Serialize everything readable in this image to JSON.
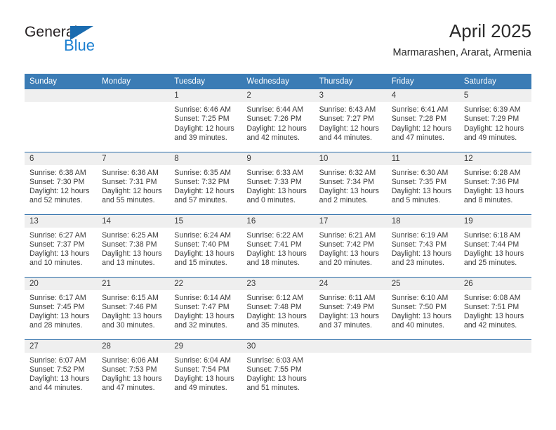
{
  "brand": {
    "name_part1": "General",
    "name_part2": "Blue",
    "logo_icon": "triangle-flag-icon",
    "accent_color": "#1b7fd0",
    "header_color": "#3b7cb5"
  },
  "header": {
    "title": "April 2025",
    "subtitle": "Marmarashen, Ararat, Armenia"
  },
  "weekday_headers": [
    "Sunday",
    "Monday",
    "Tuesday",
    "Wednesday",
    "Thursday",
    "Friday",
    "Saturday"
  ],
  "weeks": [
    [
      {
        "day": "",
        "sunrise": "",
        "sunset": "",
        "daylight_line1": "",
        "daylight_line2": ""
      },
      {
        "day": "",
        "sunrise": "",
        "sunset": "",
        "daylight_line1": "",
        "daylight_line2": ""
      },
      {
        "day": "1",
        "sunrise": "Sunrise: 6:46 AM",
        "sunset": "Sunset: 7:25 PM",
        "daylight_line1": "Daylight: 12 hours",
        "daylight_line2": "and 39 minutes."
      },
      {
        "day": "2",
        "sunrise": "Sunrise: 6:44 AM",
        "sunset": "Sunset: 7:26 PM",
        "daylight_line1": "Daylight: 12 hours",
        "daylight_line2": "and 42 minutes."
      },
      {
        "day": "3",
        "sunrise": "Sunrise: 6:43 AM",
        "sunset": "Sunset: 7:27 PM",
        "daylight_line1": "Daylight: 12 hours",
        "daylight_line2": "and 44 minutes."
      },
      {
        "day": "4",
        "sunrise": "Sunrise: 6:41 AM",
        "sunset": "Sunset: 7:28 PM",
        "daylight_line1": "Daylight: 12 hours",
        "daylight_line2": "and 47 minutes."
      },
      {
        "day": "5",
        "sunrise": "Sunrise: 6:39 AM",
        "sunset": "Sunset: 7:29 PM",
        "daylight_line1": "Daylight: 12 hours",
        "daylight_line2": "and 49 minutes."
      }
    ],
    [
      {
        "day": "6",
        "sunrise": "Sunrise: 6:38 AM",
        "sunset": "Sunset: 7:30 PM",
        "daylight_line1": "Daylight: 12 hours",
        "daylight_line2": "and 52 minutes."
      },
      {
        "day": "7",
        "sunrise": "Sunrise: 6:36 AM",
        "sunset": "Sunset: 7:31 PM",
        "daylight_line1": "Daylight: 12 hours",
        "daylight_line2": "and 55 minutes."
      },
      {
        "day": "8",
        "sunrise": "Sunrise: 6:35 AM",
        "sunset": "Sunset: 7:32 PM",
        "daylight_line1": "Daylight: 12 hours",
        "daylight_line2": "and 57 minutes."
      },
      {
        "day": "9",
        "sunrise": "Sunrise: 6:33 AM",
        "sunset": "Sunset: 7:33 PM",
        "daylight_line1": "Daylight: 13 hours",
        "daylight_line2": "and 0 minutes."
      },
      {
        "day": "10",
        "sunrise": "Sunrise: 6:32 AM",
        "sunset": "Sunset: 7:34 PM",
        "daylight_line1": "Daylight: 13 hours",
        "daylight_line2": "and 2 minutes."
      },
      {
        "day": "11",
        "sunrise": "Sunrise: 6:30 AM",
        "sunset": "Sunset: 7:35 PM",
        "daylight_line1": "Daylight: 13 hours",
        "daylight_line2": "and 5 minutes."
      },
      {
        "day": "12",
        "sunrise": "Sunrise: 6:28 AM",
        "sunset": "Sunset: 7:36 PM",
        "daylight_line1": "Daylight: 13 hours",
        "daylight_line2": "and 8 minutes."
      }
    ],
    [
      {
        "day": "13",
        "sunrise": "Sunrise: 6:27 AM",
        "sunset": "Sunset: 7:37 PM",
        "daylight_line1": "Daylight: 13 hours",
        "daylight_line2": "and 10 minutes."
      },
      {
        "day": "14",
        "sunrise": "Sunrise: 6:25 AM",
        "sunset": "Sunset: 7:38 PM",
        "daylight_line1": "Daylight: 13 hours",
        "daylight_line2": "and 13 minutes."
      },
      {
        "day": "15",
        "sunrise": "Sunrise: 6:24 AM",
        "sunset": "Sunset: 7:40 PM",
        "daylight_line1": "Daylight: 13 hours",
        "daylight_line2": "and 15 minutes."
      },
      {
        "day": "16",
        "sunrise": "Sunrise: 6:22 AM",
        "sunset": "Sunset: 7:41 PM",
        "daylight_line1": "Daylight: 13 hours",
        "daylight_line2": "and 18 minutes."
      },
      {
        "day": "17",
        "sunrise": "Sunrise: 6:21 AM",
        "sunset": "Sunset: 7:42 PM",
        "daylight_line1": "Daylight: 13 hours",
        "daylight_line2": "and 20 minutes."
      },
      {
        "day": "18",
        "sunrise": "Sunrise: 6:19 AM",
        "sunset": "Sunset: 7:43 PM",
        "daylight_line1": "Daylight: 13 hours",
        "daylight_line2": "and 23 minutes."
      },
      {
        "day": "19",
        "sunrise": "Sunrise: 6:18 AM",
        "sunset": "Sunset: 7:44 PM",
        "daylight_line1": "Daylight: 13 hours",
        "daylight_line2": "and 25 minutes."
      }
    ],
    [
      {
        "day": "20",
        "sunrise": "Sunrise: 6:17 AM",
        "sunset": "Sunset: 7:45 PM",
        "daylight_line1": "Daylight: 13 hours",
        "daylight_line2": "and 28 minutes."
      },
      {
        "day": "21",
        "sunrise": "Sunrise: 6:15 AM",
        "sunset": "Sunset: 7:46 PM",
        "daylight_line1": "Daylight: 13 hours",
        "daylight_line2": "and 30 minutes."
      },
      {
        "day": "22",
        "sunrise": "Sunrise: 6:14 AM",
        "sunset": "Sunset: 7:47 PM",
        "daylight_line1": "Daylight: 13 hours",
        "daylight_line2": "and 32 minutes."
      },
      {
        "day": "23",
        "sunrise": "Sunrise: 6:12 AM",
        "sunset": "Sunset: 7:48 PM",
        "daylight_line1": "Daylight: 13 hours",
        "daylight_line2": "and 35 minutes."
      },
      {
        "day": "24",
        "sunrise": "Sunrise: 6:11 AM",
        "sunset": "Sunset: 7:49 PM",
        "daylight_line1": "Daylight: 13 hours",
        "daylight_line2": "and 37 minutes."
      },
      {
        "day": "25",
        "sunrise": "Sunrise: 6:10 AM",
        "sunset": "Sunset: 7:50 PM",
        "daylight_line1": "Daylight: 13 hours",
        "daylight_line2": "and 40 minutes."
      },
      {
        "day": "26",
        "sunrise": "Sunrise: 6:08 AM",
        "sunset": "Sunset: 7:51 PM",
        "daylight_line1": "Daylight: 13 hours",
        "daylight_line2": "and 42 minutes."
      }
    ],
    [
      {
        "day": "27",
        "sunrise": "Sunrise: 6:07 AM",
        "sunset": "Sunset: 7:52 PM",
        "daylight_line1": "Daylight: 13 hours",
        "daylight_line2": "and 44 minutes."
      },
      {
        "day": "28",
        "sunrise": "Sunrise: 6:06 AM",
        "sunset": "Sunset: 7:53 PM",
        "daylight_line1": "Daylight: 13 hours",
        "daylight_line2": "and 47 minutes."
      },
      {
        "day": "29",
        "sunrise": "Sunrise: 6:04 AM",
        "sunset": "Sunset: 7:54 PM",
        "daylight_line1": "Daylight: 13 hours",
        "daylight_line2": "and 49 minutes."
      },
      {
        "day": "30",
        "sunrise": "Sunrise: 6:03 AM",
        "sunset": "Sunset: 7:55 PM",
        "daylight_line1": "Daylight: 13 hours",
        "daylight_line2": "and 51 minutes."
      },
      {
        "day": "",
        "sunrise": "",
        "sunset": "",
        "daylight_line1": "",
        "daylight_line2": ""
      },
      {
        "day": "",
        "sunrise": "",
        "sunset": "",
        "daylight_line1": "",
        "daylight_line2": ""
      },
      {
        "day": "",
        "sunrise": "",
        "sunset": "",
        "daylight_line1": "",
        "daylight_line2": ""
      }
    ]
  ]
}
